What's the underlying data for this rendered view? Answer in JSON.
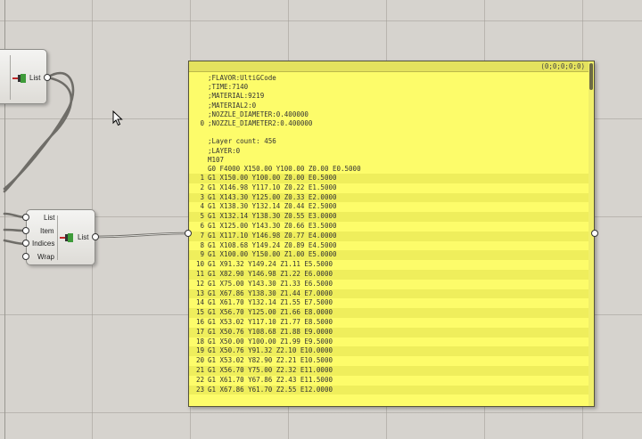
{
  "canvas": {
    "component_list": {
      "output_label": "List"
    },
    "component_list_item": {
      "inputs": [
        "List",
        "Item",
        "Indices",
        "Wrap"
      ],
      "output_label": "List"
    }
  },
  "panel": {
    "header": "(0;0;0;0;0)",
    "preamble": [
      ";FLAVOR:UltiGCode",
      ";TIME:7140",
      ";MATERIAL:9219",
      ";MATERIAL2:0",
      ";NOZZLE_DIAMETER:0.400000",
      ";NOZZLE_DIAMETER2:0.400000",
      "",
      ";Layer count: 456",
      ";LAYER:0",
      "M107",
      "G0 F4000 X150.00 Y100.00 Z0.00 E0.5000"
    ],
    "preamble_index": {
      "row": 5,
      "value": "0"
    },
    "rows": [
      {
        "i": "1",
        "t": "G1 X150.00 Y100.00 Z0.00 E0.5000"
      },
      {
        "i": "2",
        "t": "G1 X146.98 Y117.10 Z0.22 E1.5000"
      },
      {
        "i": "3",
        "t": "G1 X143.30 Y125.00 Z0.33 E2.0000"
      },
      {
        "i": "4",
        "t": "G1 X138.30 Y132.14 Z0.44 E2.5000"
      },
      {
        "i": "5",
        "t": "G1 X132.14 Y138.30 Z0.55 E3.0000"
      },
      {
        "i": "6",
        "t": "G1 X125.00 Y143.30 Z0.66 E3.5000"
      },
      {
        "i": "7",
        "t": "G1 X117.10 Y146.98 Z0.77 E4.0000"
      },
      {
        "i": "8",
        "t": "G1 X108.68 Y149.24 Z0.89 E4.5000"
      },
      {
        "i": "9",
        "t": "G1 X100.00 Y150.00 Z1.00 E5.0000"
      },
      {
        "i": "10",
        "t": "G1 X91.32 Y149.24 Z1.11 E5.5000"
      },
      {
        "i": "11",
        "t": "G1 X82.90 Y146.98 Z1.22 E6.0000"
      },
      {
        "i": "12",
        "t": "G1 X75.00 Y143.30 Z1.33 E6.5000"
      },
      {
        "i": "13",
        "t": "G1 X67.86 Y138.30 Z1.44 E7.0000"
      },
      {
        "i": "14",
        "t": "G1 X61.70 Y132.14 Z1.55 E7.5000"
      },
      {
        "i": "15",
        "t": "G1 X56.70 Y125.00 Z1.66 E8.0000"
      },
      {
        "i": "16",
        "t": "G1 X53.02 Y117.10 Z1.77 E8.5000"
      },
      {
        "i": "17",
        "t": "G1 X50.76 Y108.68 Z1.88 E9.0000"
      },
      {
        "i": "18",
        "t": "G1 X50.00 Y100.00 Z1.99 E9.5000"
      },
      {
        "i": "19",
        "t": "G1 X50.76 Y91.32 Z2.10 E10.0000"
      },
      {
        "i": "20",
        "t": "G1 X53.02 Y82.90 Z2.21 E10.5000"
      },
      {
        "i": "21",
        "t": "G1 X56.70 Y75.00 Z2.32 E11.0000"
      },
      {
        "i": "22",
        "t": "G1 X61.70 Y67.86 Z2.43 E11.5000"
      },
      {
        "i": "23",
        "t": "G1 X67.86 Y61.70 Z2.55 E12.0000"
      }
    ]
  },
  "colors": {
    "panel_bg": "#fdfc6a",
    "wire": "#6f6d68",
    "canvas_bg": "#d6d3ce"
  }
}
